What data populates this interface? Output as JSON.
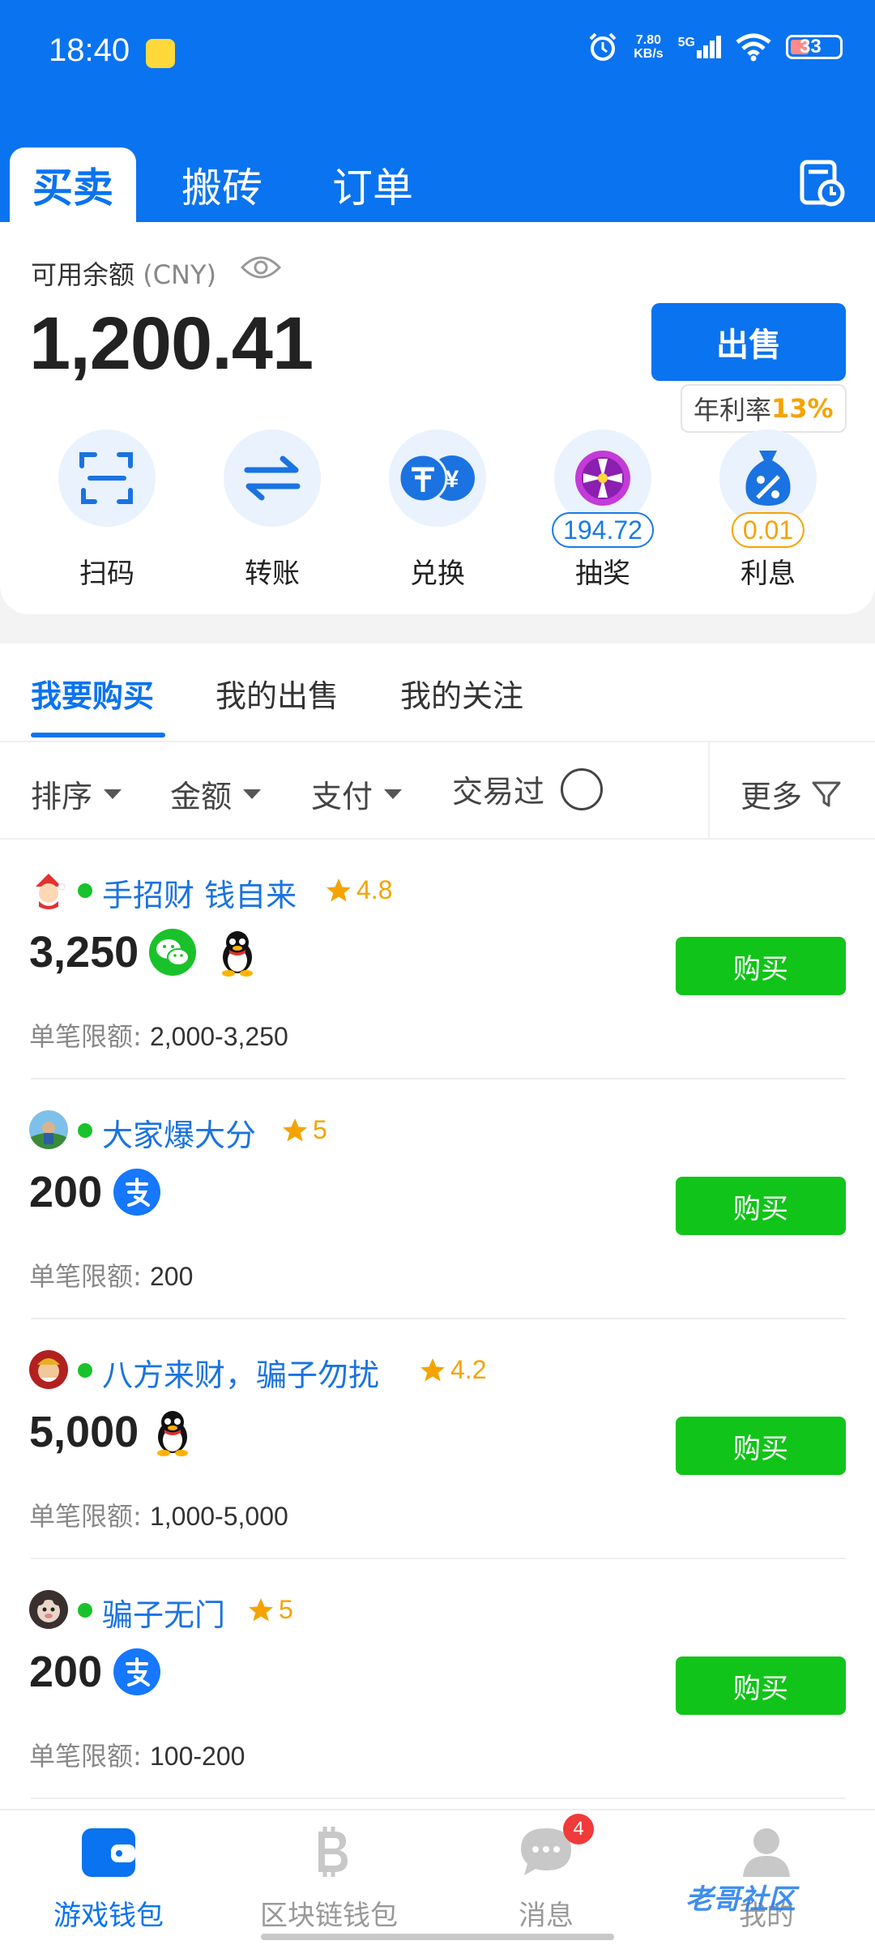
{
  "status_bar": {
    "time": "18:40",
    "speed_value": "7.80",
    "speed_unit": "KB/s",
    "network": "5G",
    "battery": "33"
  },
  "top_tabs": [
    {
      "label": "买卖",
      "active": true
    },
    {
      "label": "搬砖",
      "active": false
    },
    {
      "label": "订单",
      "active": false
    }
  ],
  "balance": {
    "label": "可用余额",
    "currency": "(CNY)",
    "amount": "1,200.41",
    "sell_label": "出售",
    "rate_tip_label": "年利率",
    "rate_tip_value": "13%"
  },
  "quick_actions": [
    {
      "label": "扫码",
      "icon": "scan-icon"
    },
    {
      "label": "转账",
      "icon": "transfer-icon"
    },
    {
      "label": "兑换",
      "icon": "exchange-icon"
    },
    {
      "label": "抽奖",
      "icon": "lottery-wheel-icon",
      "badge": "194.72"
    },
    {
      "label": "利息",
      "icon": "interest-bag-icon",
      "badge": "0.01"
    }
  ],
  "market_tabs": [
    {
      "label": "我要购买",
      "active": true
    },
    {
      "label": "我的出售",
      "active": false
    },
    {
      "label": "我的关注",
      "active": false
    }
  ],
  "filters": {
    "sort": "排序",
    "amount": "金额",
    "payment": "支付",
    "traded": "交易过",
    "more": "更多"
  },
  "listings": [
    {
      "name": "手招财 钱自来",
      "rating": "4.8",
      "amount": "3,250",
      "pay": [
        "wechat",
        "qq"
      ],
      "limit_label": "单笔限额:",
      "limit": "2,000-3,250",
      "buy_label": "购买"
    },
    {
      "name": "大家爆大分",
      "rating": "5",
      "amount": "200",
      "pay": [
        "alipay"
      ],
      "limit_label": "单笔限额:",
      "limit": "200",
      "buy_label": "购买"
    },
    {
      "name": "八方来财，骗子勿扰",
      "rating": "4.2",
      "amount": "5,000",
      "pay": [
        "qq"
      ],
      "limit_label": "单笔限额:",
      "limit": "1,000-5,000",
      "buy_label": "购买"
    },
    {
      "name": "骗子无门",
      "rating": "5",
      "amount": "200",
      "pay": [
        "alipay"
      ],
      "limit_label": "单笔限额:",
      "limit": "100-200",
      "buy_label": "购买"
    }
  ],
  "bottom_nav": [
    {
      "label": "游戏钱包",
      "icon": "wallet-icon",
      "active": true
    },
    {
      "label": "区块链钱包",
      "icon": "bitcoin-icon",
      "active": false
    },
    {
      "label": "消息",
      "icon": "chat-icon",
      "active": false,
      "badge": "4"
    },
    {
      "label": "我的",
      "icon": "user-icon",
      "active": false
    }
  ],
  "watermark": "老哥社区",
  "colors": {
    "primary": "#0a73f0",
    "buy_green": "#11c419",
    "rating_orange": "#f5a300",
    "online_green": "#19c22a",
    "badge_red": "#f13a3a"
  }
}
